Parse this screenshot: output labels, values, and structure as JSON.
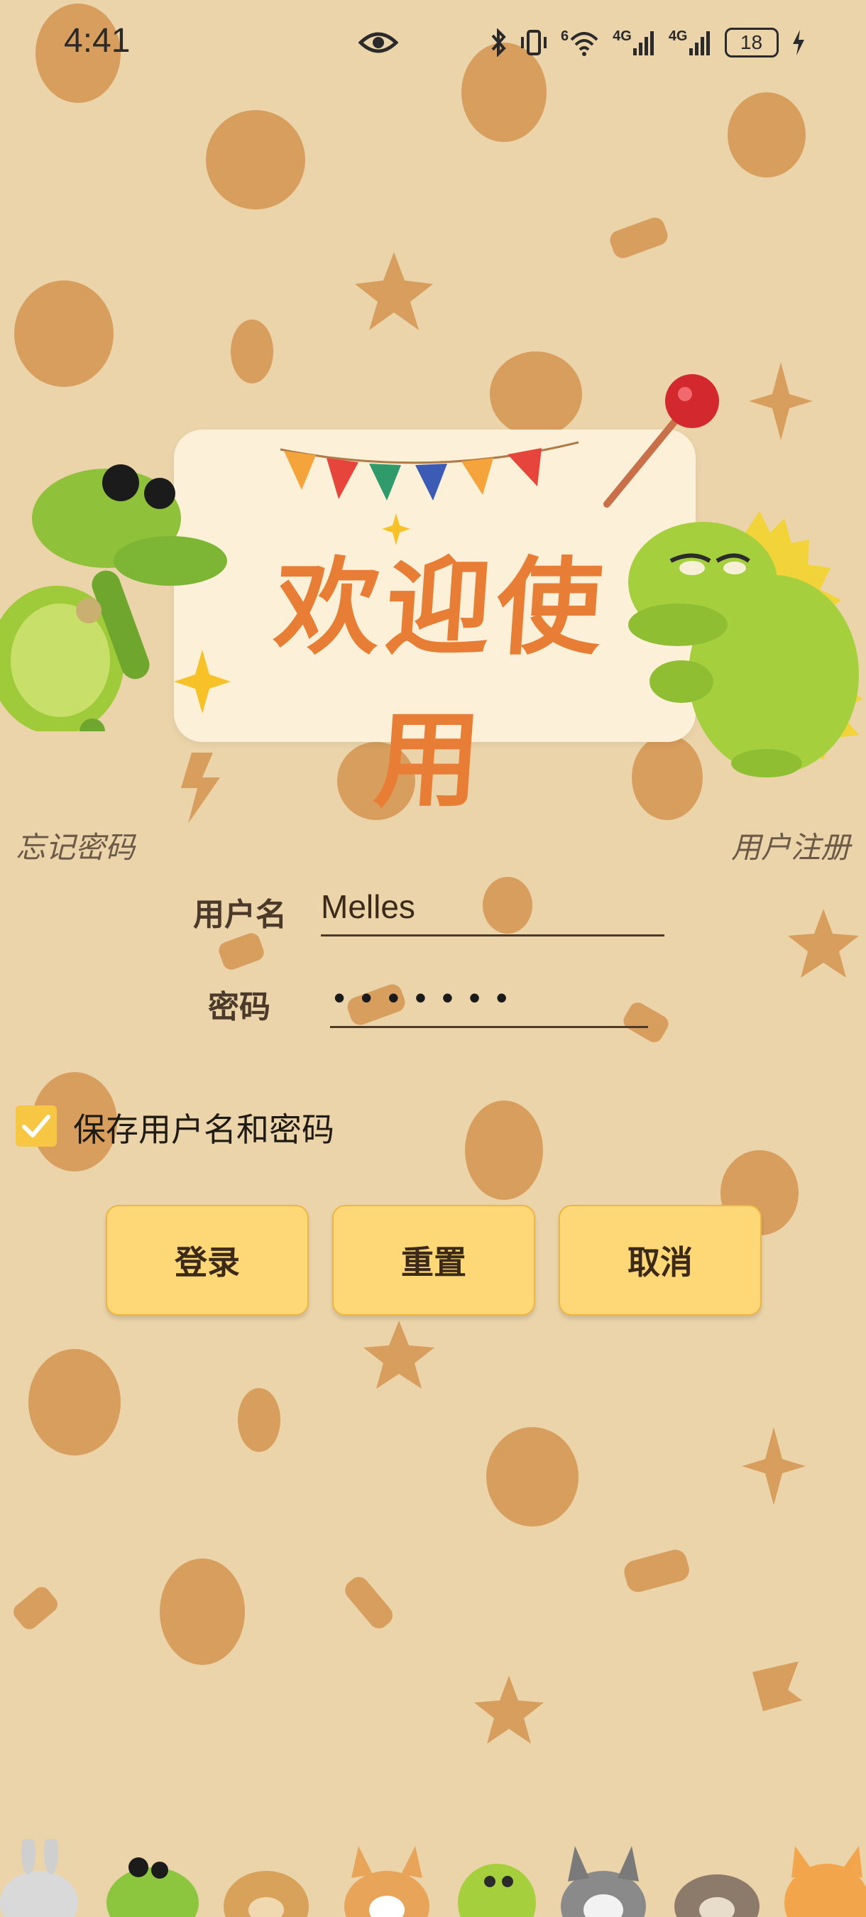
{
  "status_bar": {
    "time": "4:41",
    "wifi_badge": "6",
    "network_1": "4G",
    "network_2": "4G",
    "battery": "18"
  },
  "banner": {
    "title": "欢迎使用"
  },
  "links": {
    "forgot_password": "忘记密码",
    "register": "用户注册"
  },
  "form": {
    "username_label": "用户名",
    "username_value": "Melles",
    "password_label": "密码",
    "password_value": "•••••••"
  },
  "remember": {
    "label": "保存用户名和密码",
    "checked": true
  },
  "buttons": {
    "login": "登录",
    "reset": "重置",
    "cancel": "取消"
  },
  "colors": {
    "background": "#EBD4AA",
    "pattern": "#D39450",
    "button_fill": "#FED776",
    "checkbox": "#F7C642",
    "title": "#E87E35"
  }
}
